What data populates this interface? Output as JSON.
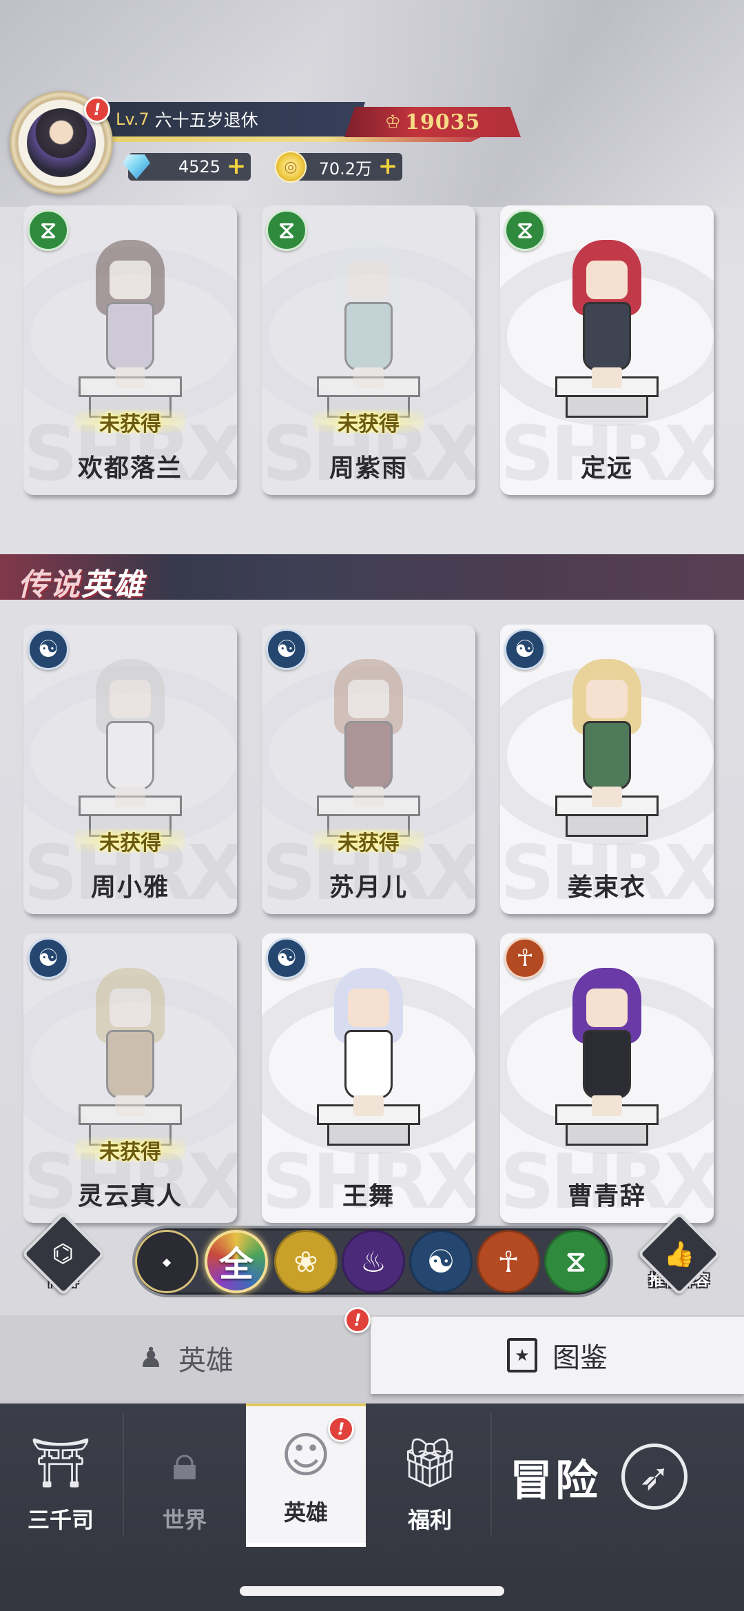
{
  "player": {
    "level": "Lv.7",
    "name": "六十五岁退休",
    "power": "19035",
    "gems": "4525",
    "coins": "70.2万",
    "alert": "!"
  },
  "cards_row1": [
    {
      "name": "欢都落兰",
      "status": "未获得",
      "faction": "dna-icon",
      "owned": false,
      "hair": "#6b3b33",
      "outfit": "#b9a3d8"
    },
    {
      "name": "周紫雨",
      "status": "未获得",
      "faction": "dna-icon",
      "owned": false,
      "hair": "#dfe6ec",
      "outfit": "#7fc4bf"
    },
    {
      "name": "定远",
      "status": "",
      "faction": "dna-icon",
      "owned": true,
      "hair": "#c23a4a",
      "outfit": "#3e4452"
    }
  ],
  "section": {
    "title_a": "传说",
    "title_b": "英雄"
  },
  "cards_row2": [
    {
      "name": "周小雅",
      "status": "未获得",
      "faction": "yinyang-icon",
      "owned": false,
      "hair": "#c8c8c8",
      "outfit": "#f2f2f2"
    },
    {
      "name": "苏月儿",
      "status": "未获得",
      "faction": "yinyang-icon",
      "owned": false,
      "hair": "#d98a64",
      "outfit": "#8a2a2a"
    },
    {
      "name": "姜束衣",
      "status": "",
      "faction": "yinyang-icon",
      "owned": true,
      "hair": "#e9d39a",
      "outfit": "#4f7a5a"
    }
  ],
  "cards_row3": [
    {
      "name": "灵云真人",
      "status": "未获得",
      "faction": "yinyang-icon",
      "owned": false,
      "hair": "#d9b95a",
      "outfit": "#c98a3a"
    },
    {
      "name": "王舞",
      "status": "",
      "faction": "yinyang-icon",
      "owned": true,
      "hair": "#d8dcf0",
      "outfit": "#ffffff"
    },
    {
      "name": "曹青辞",
      "status": "",
      "faction": "meditation-icon",
      "owned": true,
      "hair": "#6a3aa6",
      "outfit": "#2c2c34"
    }
  ],
  "filter": {
    "formation_label": "阵容",
    "all_label": "全",
    "recommend_label": "推荐阵容"
  },
  "subtabs": {
    "heroes": "英雄",
    "codex": "图鉴"
  },
  "nav": {
    "sanqiansi": "三千司",
    "world": "世界",
    "heroes": "英雄",
    "welfare": "福利",
    "adventure": "冒险"
  },
  "colors": {
    "accent_gold": "#e3c85a",
    "power_red": "#c2343d",
    "status_gold": "#6b5a12"
  }
}
